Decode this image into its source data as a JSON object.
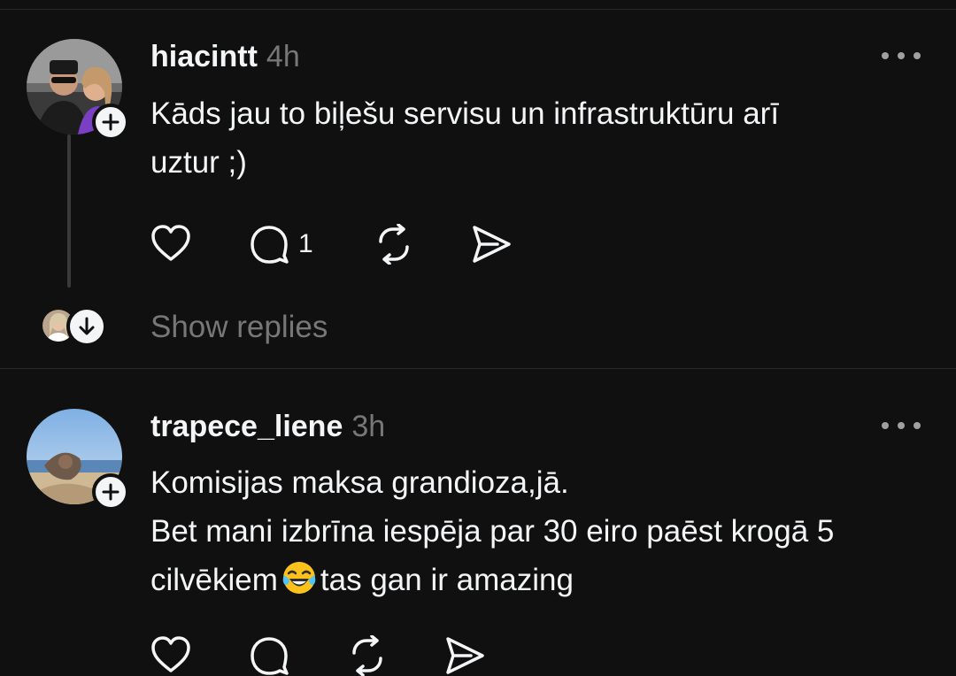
{
  "posts": [
    {
      "username": "hiacintt",
      "time": "4h",
      "text_lines": [
        "Kāds jau to biļešu servisu un infrastruktūru arī",
        "uztur ;)"
      ],
      "reply_count": "1",
      "show_replies": "Show replies"
    },
    {
      "username": "trapece_liene",
      "time": "3h",
      "text_lines": [
        "Komisijas maksa grandioza,jā.",
        "Bet mani izbrīna iespēja par 30 eiro paēst krogā 5",
        "cilvēkiem",
        "tas gan ir amazing"
      ],
      "emoji": "face-with-tears-of-joy"
    }
  ],
  "colors": {
    "background": "#101010",
    "text": "#f3f5f7",
    "muted": "#777777",
    "divider": "#2a2a2a"
  }
}
